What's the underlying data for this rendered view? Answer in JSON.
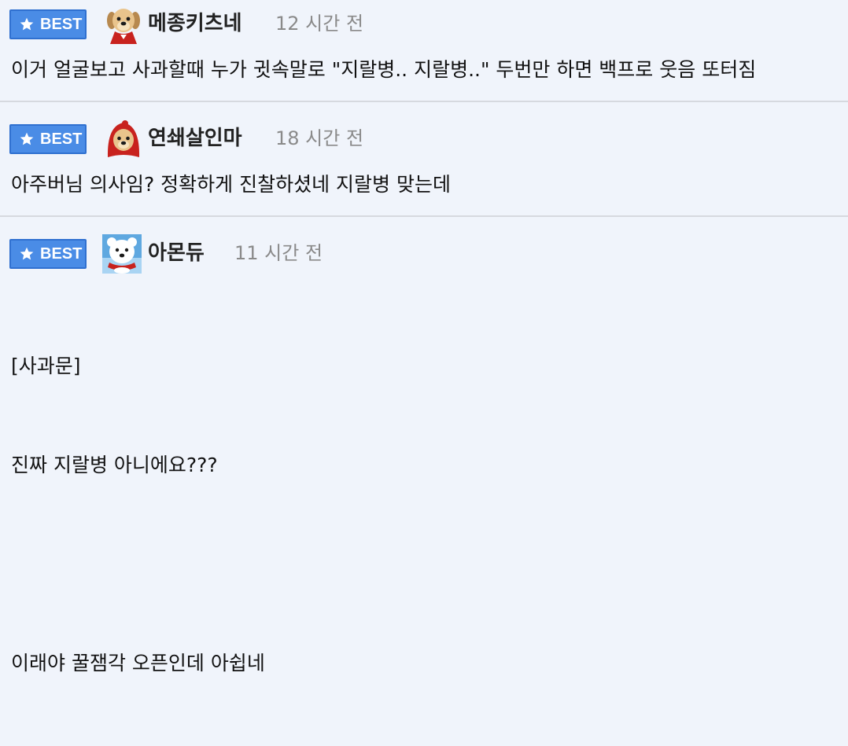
{
  "badge_label": "BEST",
  "colors": {
    "badge_bg": "#4a8ce6",
    "badge_border": "#2f70d0",
    "divider": "#d6d9df",
    "background": "#f0f4fb",
    "time_text": "#8a8a8a"
  },
  "comments": [
    {
      "avatar": "puppy-red-cape-avatar",
      "nickname": "메종키츠네",
      "time": "12 시간 전",
      "lines": [
        "이거 얼굴보고 사과할때 누가 귓속말로 \"지랄병.. 지랄병..\" 두번만 하면 백프로 웃음 또터짐"
      ]
    },
    {
      "avatar": "puppy-red-hood-avatar",
      "nickname": "연쇄살인마",
      "time": "18 시간 전",
      "lines": [
        "아주버님 의사임? 정확하게 진찰하셨네 지랄병 맞는데"
      ]
    },
    {
      "avatar": "polar-bear-avatar",
      "nickname": "아몬듀",
      "time": "11 시간 전",
      "lines": [
        "[사과문]",
        "진짜 지랄병 아니에요???",
        "",
        "이래야 꿀잼각 오픈인데 아쉽네"
      ]
    }
  ]
}
